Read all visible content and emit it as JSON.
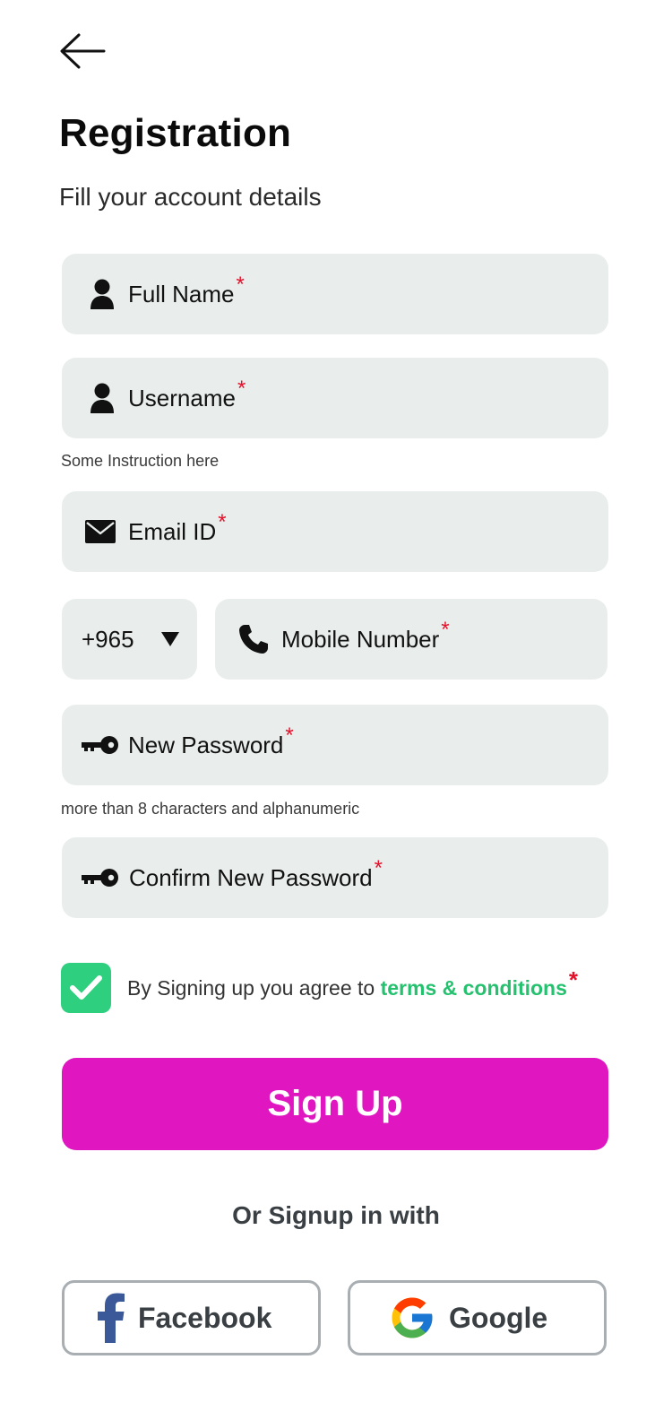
{
  "header": {
    "title": "Registration",
    "subtitle": "Fill your account details"
  },
  "form": {
    "full_name": {
      "label": "Full Name",
      "required_mark": "*",
      "icon": "user-icon"
    },
    "username": {
      "label": "Username",
      "required_mark": "*",
      "icon": "user-icon",
      "hint": "Some Instruction here"
    },
    "email": {
      "label": "Email ID",
      "required_mark": "*",
      "icon": "envelope-icon"
    },
    "country_code": {
      "value": "+965",
      "icon": "caret-down-icon"
    },
    "mobile": {
      "label": "Mobile Number",
      "required_mark": "*",
      "icon": "phone-icon"
    },
    "new_password": {
      "label": "New Password",
      "required_mark": "*",
      "icon": "key-icon",
      "hint": "more than 8 characters and alphanumeric"
    },
    "confirm_password": {
      "label": "Confirm New Password",
      "required_mark": "*",
      "icon": "key-icon"
    }
  },
  "terms": {
    "checked": true,
    "text": "By Signing up you agree to ",
    "link": "terms & conditions",
    "required_mark": "*"
  },
  "actions": {
    "signup_label": "Sign Up",
    "or_text": "Or Signup in with",
    "facebook_label": "Facebook",
    "google_label": "Google"
  },
  "colors": {
    "field_bg": "#e9eeec",
    "accent": "#e016c1",
    "check": "#2ecf7e",
    "link": "#24c16e",
    "required": "#e5102a"
  }
}
